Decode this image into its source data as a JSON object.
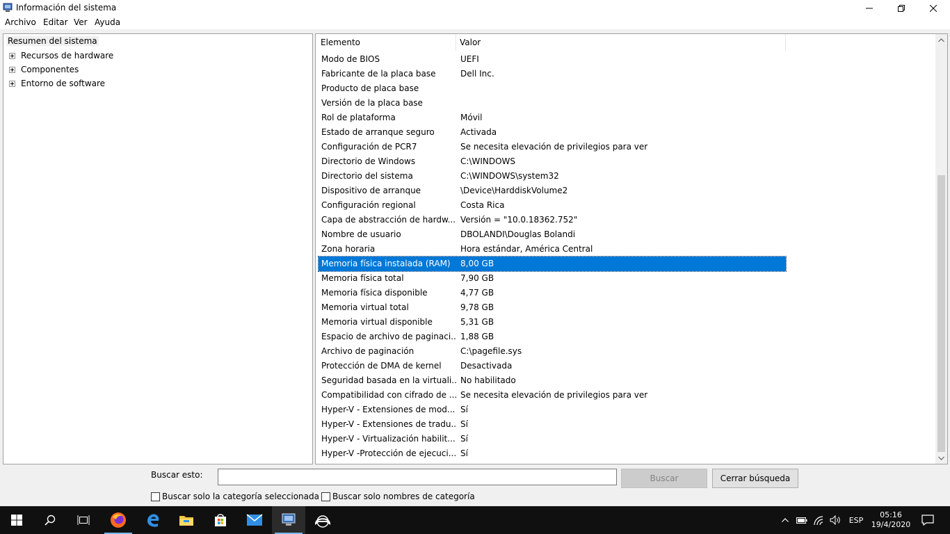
{
  "window": {
    "title": "Información del sistema"
  },
  "menu": [
    "Archivo",
    "Editar",
    "Ver",
    "Ayuda"
  ],
  "tree": {
    "root": "Resumen del sistema",
    "nodes": [
      "Recursos de hardware",
      "Componentes",
      "Entorno de software"
    ]
  },
  "list": {
    "columns": [
      "Elemento",
      "Valor"
    ],
    "rows": [
      {
        "name": "Modo de BIOS",
        "value": "UEFI"
      },
      {
        "name": "Fabricante de la placa base",
        "value": "Dell Inc."
      },
      {
        "name": "Producto de placa base",
        "value": ""
      },
      {
        "name": "Versión de la placa base",
        "value": ""
      },
      {
        "name": "Rol de plataforma",
        "value": "Móvil"
      },
      {
        "name": "Estado de arranque seguro",
        "value": "Activada"
      },
      {
        "name": "Configuración de PCR7",
        "value": "Se necesita elevación de privilegios para ver"
      },
      {
        "name": "Directorio de Windows",
        "value": "C:\\WINDOWS"
      },
      {
        "name": "Directorio del sistema",
        "value": "C:\\WINDOWS\\system32"
      },
      {
        "name": "Dispositivo de arranque",
        "value": "\\Device\\HarddiskVolume2"
      },
      {
        "name": "Configuración regional",
        "value": "Costa Rica"
      },
      {
        "name": "Capa de abstracción de hardw...",
        "value": "Versión = \"10.0.18362.752\""
      },
      {
        "name": "Nombre de usuario",
        "value": "DBOLANDI\\Douglas Bolandi"
      },
      {
        "name": "Zona horaria",
        "value": "Hora estándar, América Central"
      },
      {
        "name": "Memoria física instalada (RAM)",
        "value": "8,00 GB"
      },
      {
        "name": "Memoria física total",
        "value": "7,90 GB"
      },
      {
        "name": "Memoria física disponible",
        "value": "4,77 GB"
      },
      {
        "name": "Memoria virtual total",
        "value": "9,78 GB"
      },
      {
        "name": "Memoria virtual disponible",
        "value": "5,31 GB"
      },
      {
        "name": "Espacio de archivo de paginaci...",
        "value": "1,88 GB"
      },
      {
        "name": "Archivo de paginación",
        "value": "C:\\pagefile.sys"
      },
      {
        "name": "Protección de DMA de kernel",
        "value": "Desactivada"
      },
      {
        "name": "Seguridad basada en la virtuali...",
        "value": "No habilitado"
      },
      {
        "name": "Compatibilidad con cifrado de ...",
        "value": "Se necesita elevación de privilegios para ver"
      },
      {
        "name": "Hyper-V - Extensiones de mod...",
        "value": "Sí"
      },
      {
        "name": "Hyper-V - Extensiones de tradu...",
        "value": "Sí"
      },
      {
        "name": "Hyper-V - Virtualización habilit...",
        "value": "Sí"
      },
      {
        "name": "Hyper-V -Protección de ejecuci...",
        "value": "Sí"
      }
    ],
    "selected_index": 14
  },
  "search": {
    "label": "Buscar esto:",
    "value": "",
    "search_button": "Buscar",
    "close_button": "Cerrar búsqueda",
    "option_selected_category": "Buscar solo la categoría seleccionada",
    "option_category_names": "Buscar solo nombres de categoría"
  },
  "taskbar": {
    "language": "ESP",
    "time": "05:16",
    "date": "19/4/2020"
  },
  "colors": {
    "selection": "#0078d7",
    "taskbar": "#101010",
    "accent_underline": "#76b9ed"
  }
}
